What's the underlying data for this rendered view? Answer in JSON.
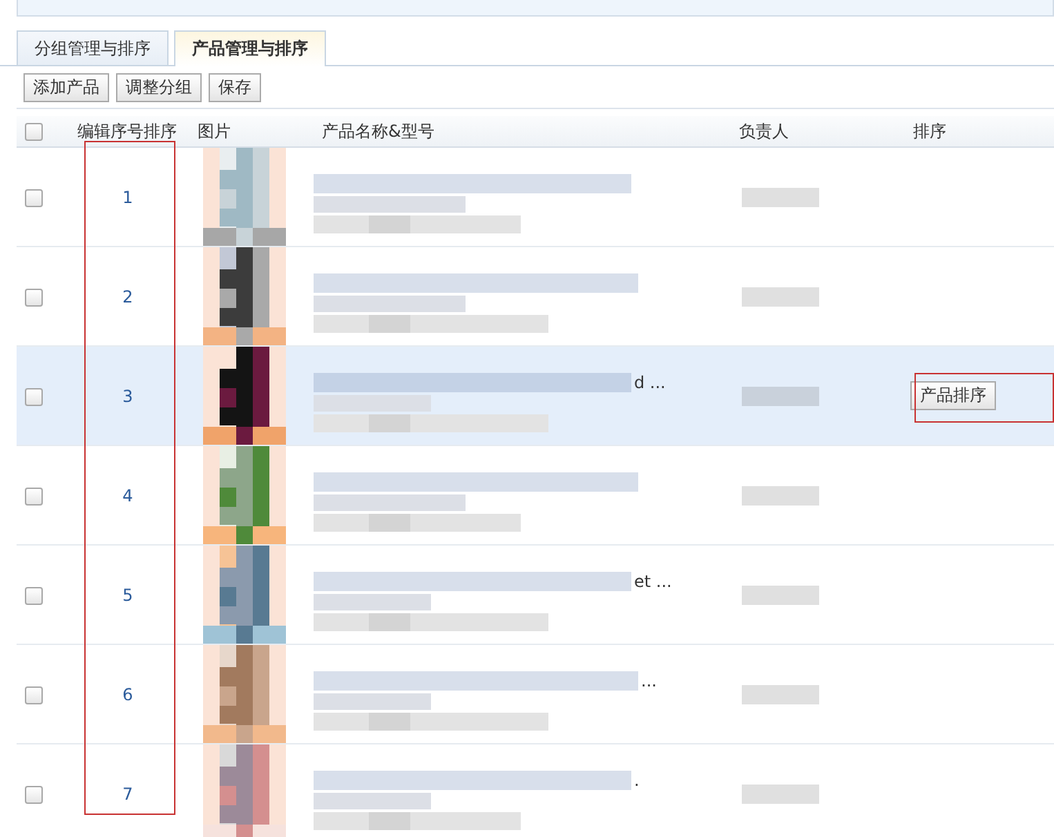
{
  "tabs": [
    {
      "label": "分组管理与排序",
      "selected": false
    },
    {
      "label": "产品管理与排序",
      "selected": true
    }
  ],
  "toolbar": {
    "buttons": [
      "添加产品",
      "调整分组",
      "保存"
    ]
  },
  "table": {
    "select_all": {
      "checked": false
    },
    "columns": [
      "编辑序号排序",
      "图片",
      "产品名称&型号",
      "负责人",
      "排序"
    ],
    "rows": [
      {
        "checked": false,
        "selected": false,
        "number": "1"
      },
      {
        "checked": false,
        "selected": false,
        "number": "2"
      },
      {
        "checked": false,
        "selected": true,
        "number": "3",
        "name_tail": "d ...",
        "sort_button": "产品排序"
      },
      {
        "checked": false,
        "selected": false,
        "number": "4"
      },
      {
        "checked": false,
        "selected": false,
        "number": "5",
        "name_tail": "et ..."
      },
      {
        "checked": false,
        "selected": false,
        "number": "6",
        "name_tail": "..."
      },
      {
        "checked": false,
        "selected": false,
        "number": "7",
        "name_tail": "."
      }
    ]
  }
}
